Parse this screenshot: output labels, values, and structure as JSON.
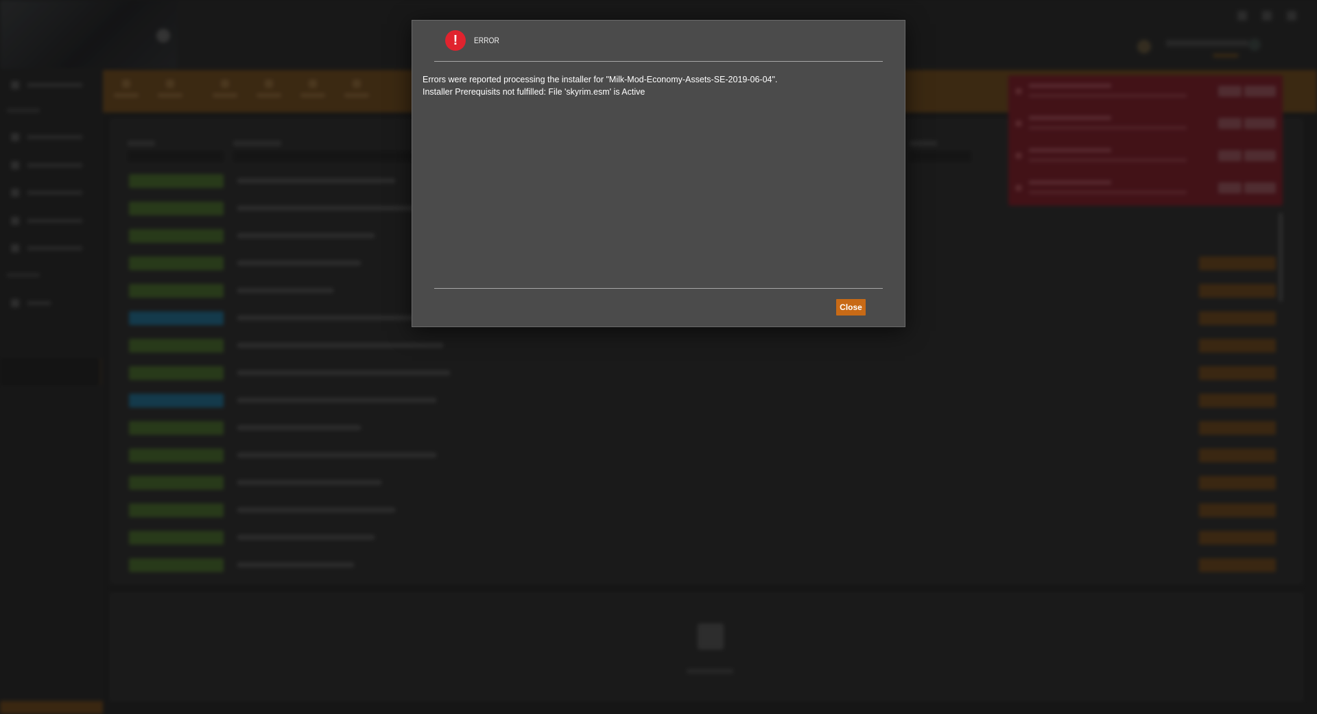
{
  "dialog": {
    "title": "ERROR",
    "icon": "error-icon",
    "message_line1": "Errors were reported processing the installer for \"Milk-Mod-Economy-Assets-SE-2019-06-04\".",
    "message_line2": "Installer Prerequisits not fulfilled: File 'skyrim.esm' is Active",
    "close_label": "Close"
  },
  "colors": {
    "accent": "#c86a16",
    "error_red": "#e0232e",
    "notification_red": "#8e1624",
    "status_enabled": "#4e7a2a",
    "status_other": "#1a7aa6"
  },
  "background": {
    "mod_rows": [
      {
        "status_color": "#4e7a2a"
      },
      {
        "status_color": "#4e7a2a"
      },
      {
        "status_color": "#4e7a2a"
      },
      {
        "status_color": "#4e7a2a"
      },
      {
        "status_color": "#4e7a2a"
      },
      {
        "status_color": "#1a7aa6"
      },
      {
        "status_color": "#4e7a2a"
      },
      {
        "status_color": "#4e7a2a"
      },
      {
        "status_color": "#1a7aa6"
      },
      {
        "status_color": "#4e7a2a"
      },
      {
        "status_color": "#4e7a2a"
      },
      {
        "status_color": "#4e7a2a"
      },
      {
        "status_color": "#4e7a2a"
      },
      {
        "status_color": "#4e7a2a"
      },
      {
        "status_color": "#4e7a2a"
      }
    ],
    "notification_count": 4
  }
}
